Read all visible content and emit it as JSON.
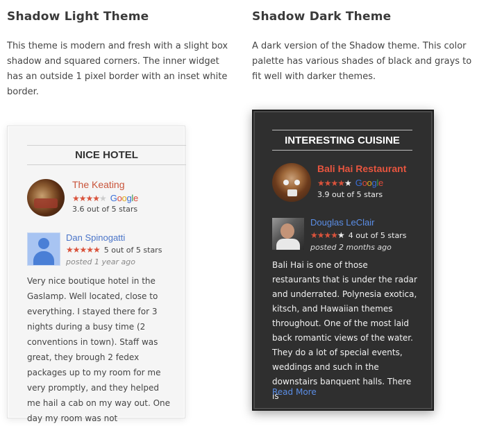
{
  "light": {
    "title": "Shadow Light Theme",
    "description": "This theme is modern and fresh with a slight box shadow and squared corners. The inner widget has an outside 1 pixel border with an inset white border.",
    "widget_title": "NICE HOTEL",
    "business_name": "The Keating",
    "business_rating": "3.6 out of 5 stars",
    "business_stars": "★★★★",
    "business_stars_off": "★",
    "reviewer_name": "Dan Spinogatti",
    "review_stars": "★★★★★",
    "review_rating": "5 out of 5 stars",
    "review_time": "posted 1 year ago",
    "review_text": "Very nice boutique hotel in the Gaslamp. Well located, close to everything. I stayed there for 3 nights during a busy time (2 conventions in town). Staff was great, they brough 2 fedex packages up to my room for me very promptly, and they helped me hail a cab on my way out. One day my room was not"
  },
  "dark": {
    "title": "Shadow Dark Theme",
    "description": "A dark version of the Shadow theme. This color palette has various shades of black and grays to fit well with darker themes.",
    "widget_title": "INTERESTING CUISINE",
    "business_name": "Bali Hai Restaurant",
    "business_rating": "3.9 out of 5 stars",
    "business_stars": "★★★★",
    "business_stars_off": "★",
    "reviewer_name": "Douglas LeClair",
    "review_stars": "★★★★",
    "review_stars_off": "★",
    "review_rating": "4 out of 5 stars",
    "review_time": "posted 2 months ago",
    "review_text": "Bali Hai is one of those restaurants that is under the radar and underrated. Polynesia exotica, kitsch, and Hawaiian themes throughout. One of the most laid back romantic views of the water. They do a lot of special events, weddings and such in the downstairs banquent halls. There is",
    "read_more": "Read More"
  },
  "google_logo": "Google",
  "colors": {
    "star": "#d9533c",
    "business_name_light": "#c9543a",
    "business_name_dark": "#e8553f",
    "reviewer_link": "#4a74c8",
    "dark_bg": "#2f2f2f"
  }
}
